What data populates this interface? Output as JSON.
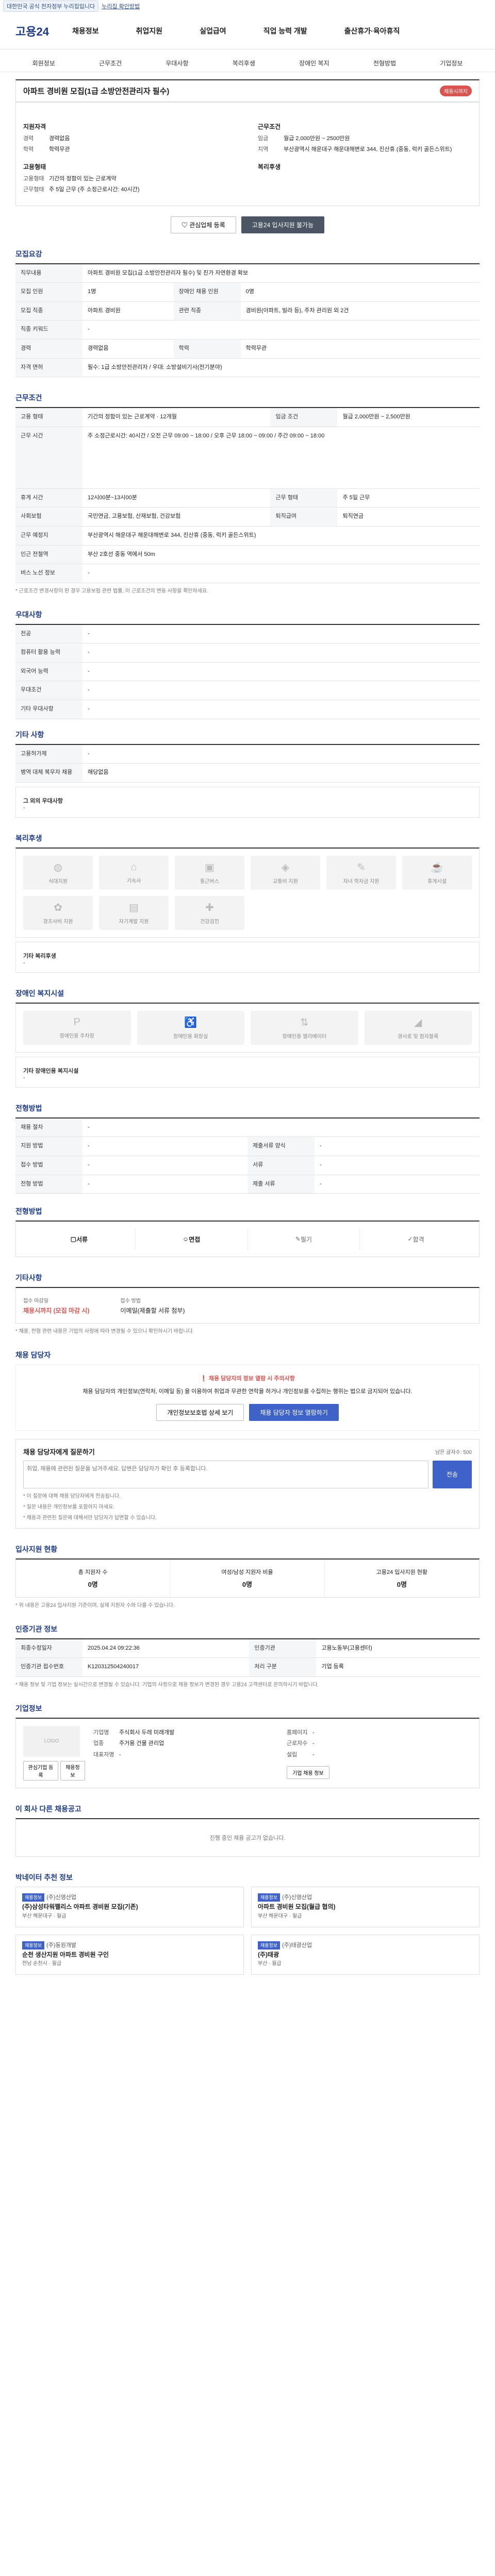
{
  "topbar": {
    "notice": "대한민국 공식 전자정부 누리집입니다",
    "link": "누리집 확인방법"
  },
  "header": {
    "logo": "고용24",
    "menu": [
      "채용정보",
      "취업지원",
      "실업급여",
      "직업 능력 개발",
      "출산휴가·육아휴직"
    ]
  },
  "subnav": [
    "회원정보",
    "근무조건",
    "우대사항",
    "복리후생",
    "장애인 복지",
    "전형방법",
    "기업정보"
  ],
  "job": {
    "title": "아파트 경비원 모집(1급 소방안전관리자 필수)",
    "badge": "채용시까지",
    "qual_title": "지원자격",
    "qual": [
      {
        "k": "경력",
        "v": "경력없음"
      },
      {
        "k": "학력",
        "v": "학력무관"
      }
    ],
    "cond_title": "근무조건",
    "cond": [
      {
        "k": "임금",
        "v": "월급 2,000만원 ~ 2500만원"
      },
      {
        "k": "지역",
        "v": "부산광역시 해운대구 해운대해변로 344, 진산휴 (중동, 럭키 골든스위트)"
      }
    ],
    "type_title": "고용형태",
    "type": [
      {
        "k": "고용형태",
        "v": "기간의 정함이 있는 근로계약"
      },
      {
        "k": "근무형태",
        "v": "주 5일 근무 (주 소정근로시간: 40시간)"
      }
    ],
    "welfare_title": "복리후생",
    "btn_apply": "관심업체 등록",
    "btn_save": "고용24 입사지원 불가능"
  },
  "sections": {
    "recruit": "모집요강",
    "work": "근무조건",
    "pref": "우대사항",
    "benefit": "복리후생",
    "disab": "장애인 복지시설",
    "process": "전형방법",
    "contact": "채용 담당자",
    "stats": "입사지원 현황",
    "history": "인증기관 정보",
    "company": "기업정보",
    "others": "이 회사 다른 채용공고",
    "recommend": "박네이터 추천 정보"
  },
  "recruit": {
    "duty_label": "직무내용",
    "duty": "아파트 경비원 모집(1급 소방안전관리자 필수) 및 친가 자연환경 확보",
    "rows": [
      {
        "k": "모집 인원",
        "v": "1명",
        "k2": "장애인 채용 인원",
        "v2": "0명"
      },
      {
        "k": "모집 직종",
        "v": "아파트 경비원",
        "k2": "관련 직종",
        "v2": "경비원(아파트, 빌라 등), 주차 관리원 외 2건"
      },
      {
        "k": "직종 키워드",
        "v": "-",
        "k2": "",
        "v2": ""
      },
      {
        "k": "경력",
        "v": "경력없음",
        "k2": "학력",
        "v2": "학력무관"
      },
      {
        "k": "자격 면허",
        "v": "필수: 1급 소방안전관리자 / 우대: 소방설비기사(전기분야)",
        "k2": "",
        "v2": ""
      }
    ]
  },
  "work": {
    "rows": [
      {
        "k": "고용 형태",
        "v": "기간의 정함이 있는 근로계약 · 12개월",
        "k2": "임금 조건",
        "v2": "월급 2,000만원 ~ 2,500만원"
      },
      {
        "k": "근무 시간",
        "v": "주 소정근로시간: 40시간 / 오전 근무 09:00 ~ 18:00 / 오후 근무 18:00 ~ 09:00 / 주간 09:00 ~ 18:00",
        "k2": "",
        "v2": ""
      },
      {
        "k": "휴게 시간",
        "v": "12시00분~13시00분",
        "k2": "근무 형태",
        "v2": "주 5일 근무"
      },
      {
        "k": "사회보험",
        "v": "국민연금, 고용보험, 산재보험, 건강보험",
        "k2": "퇴직급여",
        "v2": "퇴직연금"
      },
      {
        "k": "근무 예정지",
        "v": "부산광역시 해운대구 해운대해변로 344, 진산휴 (중동, 럭키 골든스위트)",
        "k2": "",
        "v2": ""
      },
      {
        "k": "인근 전철역",
        "v": "부산 2호선 중동 역에서 50m",
        "k2": "",
        "v2": ""
      },
      {
        "k": "버스 노선 정보",
        "v": "-",
        "k2": "",
        "v2": ""
      }
    ],
    "note": "* 근로조건 변경사항이 된 경우 고용보험 관련 법률, 이 근로조건의 변동 사항을 확인하세요."
  },
  "pref": {
    "rows": [
      {
        "k": "전공",
        "v": "-"
      },
      {
        "k": "컴퓨터 활용 능력",
        "v": "-"
      },
      {
        "k": "외국어 능력",
        "v": "-"
      },
      {
        "k": "우대조건",
        "v": "-"
      },
      {
        "k": "기타 우대사항",
        "v": "-"
      }
    ],
    "sub_title": "기타 사항",
    "sub_rows": [
      {
        "k": "고용허가제",
        "v": "-"
      },
      {
        "k": "병역 대체 복무자 채용",
        "v": "해당없음"
      }
    ],
    "extra_title": "그 외의 우대사항",
    "extra": "-"
  },
  "benefit": {
    "icons": [
      "식대지원",
      "기숙사",
      "통근버스",
      "교통비 지원",
      "자녀 학자금 지원",
      "휴게시설",
      "경조사비 지원",
      "자기계발 지원",
      "건강검진"
    ],
    "extra_title": "기타 복리후생",
    "extra": "-"
  },
  "disab": {
    "icons": [
      "장애인용 주차장",
      "장애인용 화장실",
      "장애인용 엘리베이터",
      "경사로 및 점자블록"
    ],
    "extra_title": "기타 장애인용 복지시설",
    "extra": "-"
  },
  "process": {
    "rows": [
      {
        "k": "채용 절차",
        "v": "-",
        "k2": "",
        "v2": ""
      },
      {
        "k": "지원 방법",
        "v": "-",
        "k2": "제출서류 양식",
        "v2": "-"
      },
      {
        "k": "접수 방법",
        "v": "-",
        "k2": "서류",
        "v2": "-"
      },
      {
        "k": "전형 방법",
        "v": "-",
        "k2": "제출 서류",
        "v2": "-"
      }
    ],
    "steps_title": "전형방법",
    "steps": [
      "서류",
      "면접",
      "필기",
      "합격"
    ]
  },
  "apply": {
    "title": "기타사항",
    "rows": [
      {
        "k": "접수 마감일",
        "v": "채용시까지 (모집 마감 시)"
      },
      {
        "k": "접수 방법",
        "v": "이메일(제출할 서류 첨부)"
      }
    ],
    "note": "* 채용, 전형 관련 내용은 기업의 사정에 따라 변경될 수 있으니 확인하시기 바랍니다."
  },
  "contact": {
    "alert_title": "채용 담당자의 정보 열람 시 주의사항",
    "alert_body": "채용 담당자의 개인정보(연락처, 이메일 등) 을 이용하여 취업과 무관한 연락을 하거나 개인정보를 수집하는 행위는 법으로 금지되어 있습니다.",
    "btn1": "개인정보보호법 상세 보기",
    "btn2": "채용 담당자 정보 열람하기",
    "qa_title": "채용 담당자에게 질문하기",
    "qa_hint": "남은 글자수: 500",
    "qa_placeholder": "취업, 채용에 관련된 질문을 남겨주세요. 답변은 담당자가 확인 후 등록합니다.",
    "qa_btn": "전송",
    "qa_notes": [
      "* 이 질문에 대해 채용 담당자에게 전송됩니다.",
      "* 질문 내용은 개인정보를 포함하지 마세요.",
      "* 채용과 관련된 질문에 대해서만 담당자가 답변할 수 있습니다."
    ]
  },
  "stats": {
    "items": [
      {
        "label": "총 지원자 수",
        "value": "0명"
      },
      {
        "label": "여성/남성 지원자 비율",
        "value": "0명"
      },
      {
        "label": "고용24 입사지원 현황",
        "value": "0명"
      }
    ],
    "note": "* 위 내용은 고용24 입사지원 기준이며, 실제 지원자 수와 다를 수 있습니다."
  },
  "history": {
    "rows": [
      {
        "k": "최종수정일자",
        "v": "2025.04.24 09:22:36",
        "k2": "인증기관",
        "v2": "고용노동부(고용센터)"
      },
      {
        "k": "인증기관 접수번호",
        "v": "K120312504240017",
        "k2": "처리 구분",
        "v2": "기업 등록"
      }
    ],
    "note": "* 채용 정보 및 기업 정보는 실시간으로 변경될 수 있습니다. 기업의 사정으로 채용 정보가 변경된 경우 고용24 고객센터로 문의하시기 바랍니다."
  },
  "company": {
    "name_label": "기업명",
    "logo": "LOGO",
    "links": [
      "관심기업 등록",
      "채용정보"
    ],
    "left": [
      {
        "k": "기업명",
        "v": "주식회사 두레 미래개발"
      },
      {
        "k": "업종",
        "v": "주거용 건물 관리업"
      },
      {
        "k": "대표자명",
        "v": "-"
      }
    ],
    "right": [
      {
        "k": "홈페이지",
        "v": "-"
      },
      {
        "k": "근로자수",
        "v": "-"
      },
      {
        "k": "설립",
        "v": "-"
      }
    ],
    "btn": "기업 채용 정보"
  },
  "others": {
    "empty": "진행 중인 채용 공고가 없습니다."
  },
  "recommend": {
    "cards": [
      {
        "tag": "채용정보",
        "co": "(주)신영산업",
        "title": "(주)삼성타워팰리스 아파트 경비원 모집(기존)",
        "meta": "부산 해운대구 · 월급"
      },
      {
        "tag": "채용정보",
        "co": "(주)신영산업",
        "title": "아파트 경비원 모집(월급 협의)",
        "meta": "부산 해운대구 · 월급"
      },
      {
        "tag": "채용정보",
        "co": "(주)동원개발",
        "title": "순천 생산지원 아파트 경비원 구인",
        "meta": "전남 순천시 · 월급"
      },
      {
        "tag": "채용정보",
        "co": "(주)태광산업",
        "title": "(주)태광",
        "meta": "부산 · 월급"
      }
    ]
  }
}
